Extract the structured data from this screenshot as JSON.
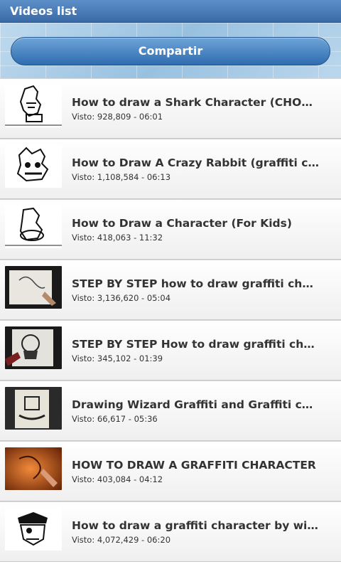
{
  "app": {
    "title": "Videos list"
  },
  "share": {
    "label": "Compartir"
  },
  "videos": [
    {
      "title": "How to draw a Shark Character (CHOLO SHARK)",
      "meta": "Visto: 928,809 - 06:01",
      "thumb": "white"
    },
    {
      "title": "How to Draw A Crazy Rabbit (graffiti character)",
      "meta": "Visto: 1,108,584 - 06:13",
      "thumb": "white"
    },
    {
      "title": "How to Draw a Character (For Kids)",
      "meta": "Visto: 418,063 - 11:32",
      "thumb": "white"
    },
    {
      "title": "STEP BY STEP how to draw graffiti character",
      "meta": "Visto: 3,136,620 - 05:04",
      "thumb": "dark"
    },
    {
      "title": "STEP BY STEP How to draw graffiti character",
      "meta": "Visto: 345,102 - 01:39",
      "thumb": "dark"
    },
    {
      "title": "Drawing Wizard Graffiti and Graffiti character",
      "meta": "Visto: 66,617 - 05:36",
      "thumb": "dark"
    },
    {
      "title": "HOW TO DRAW A GRAFFITI CHARACTER",
      "meta": "Visto: 403,084 - 04:12",
      "thumb": "orange"
    },
    {
      "title": "How to draw a graffiti character by wizard",
      "meta": "Visto: 4,072,429 - 06:20",
      "thumb": "white"
    }
  ]
}
